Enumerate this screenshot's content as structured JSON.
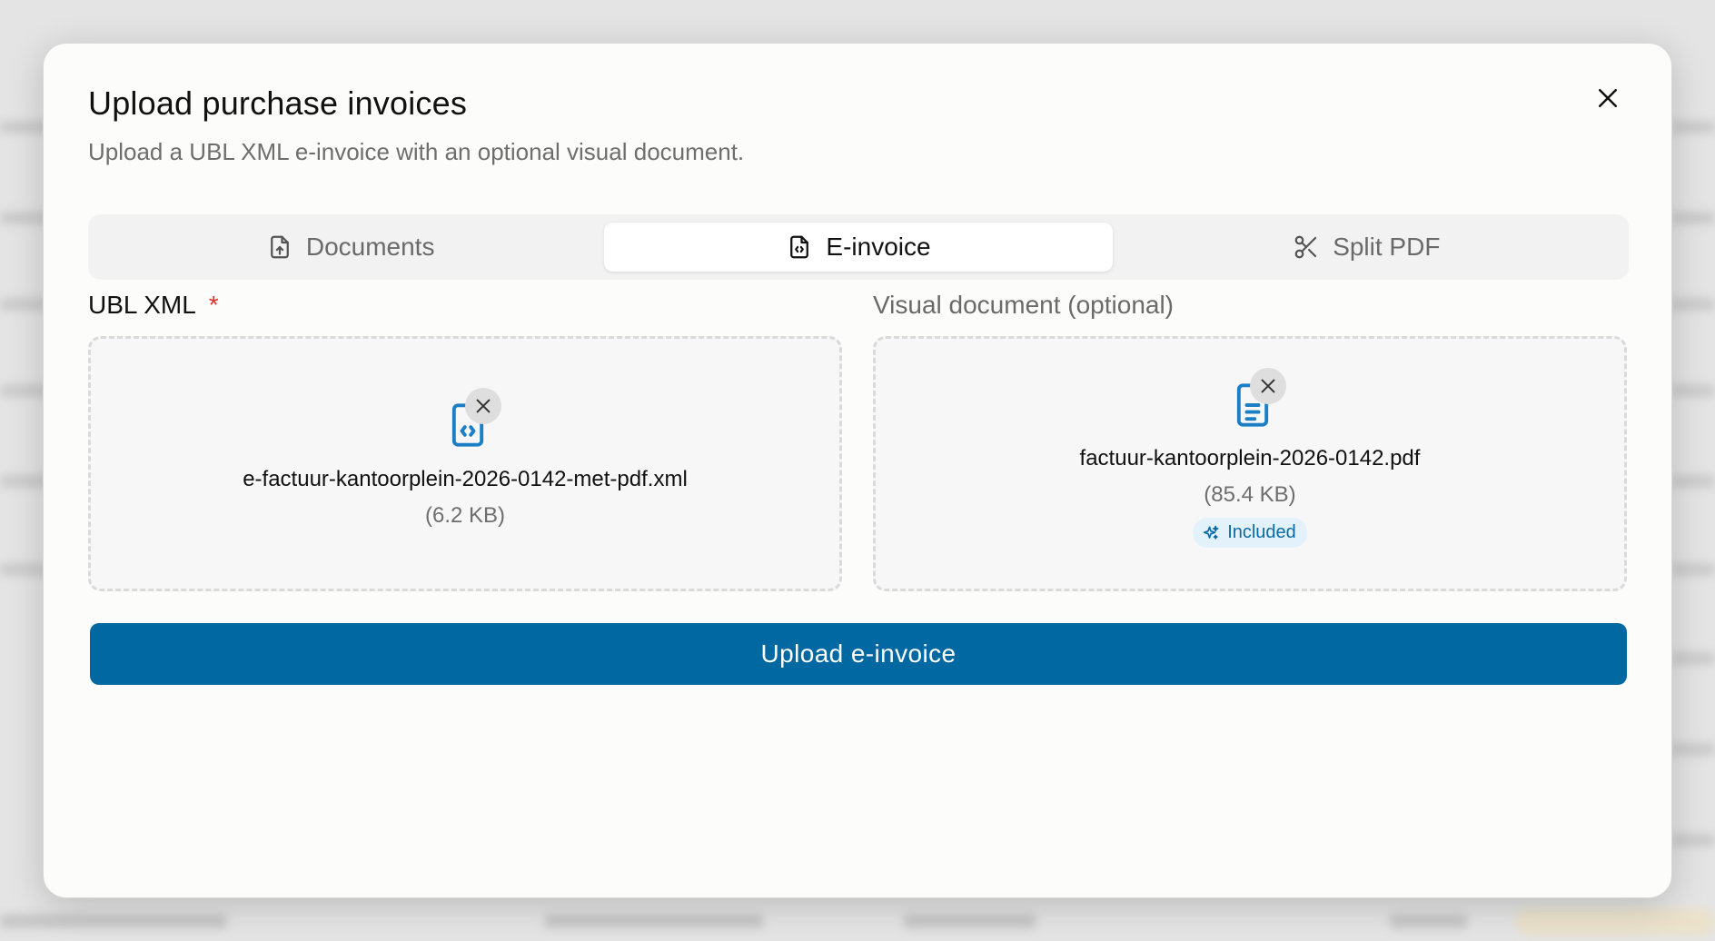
{
  "modal": {
    "title": "Upload purchase invoices",
    "subtitle": "Upload a UBL XML e-invoice with an optional visual document.",
    "close_icon": "x-icon"
  },
  "tabs": [
    {
      "label": "Documents",
      "icon": "file-upload-icon",
      "active": false
    },
    {
      "label": "E-invoice",
      "icon": "file-code-icon",
      "active": true
    },
    {
      "label": "Split PDF",
      "icon": "scissors-icon",
      "active": false
    }
  ],
  "fields": {
    "xml": {
      "label": "UBL XML",
      "required_mark": "*",
      "file_name": "e-factuur-kantoorplein-2026-0142-met-pdf.xml",
      "file_size": "(6.2 KB)",
      "icon": "file-code-icon"
    },
    "visual": {
      "label": "Visual document (optional)",
      "file_name": "factuur-kantoorplein-2026-0142.pdf",
      "file_size": "(85.4 KB)",
      "icon": "file-text-icon",
      "badge": "Included",
      "badge_icon": "sparkles-icon"
    }
  },
  "actions": {
    "upload_label": "Upload e-invoice"
  },
  "colors": {
    "primary": "#0268a2",
    "icon_blue": "#1a7fc4",
    "required": "#d9342b",
    "badge_bg": "#e3f1fb"
  }
}
